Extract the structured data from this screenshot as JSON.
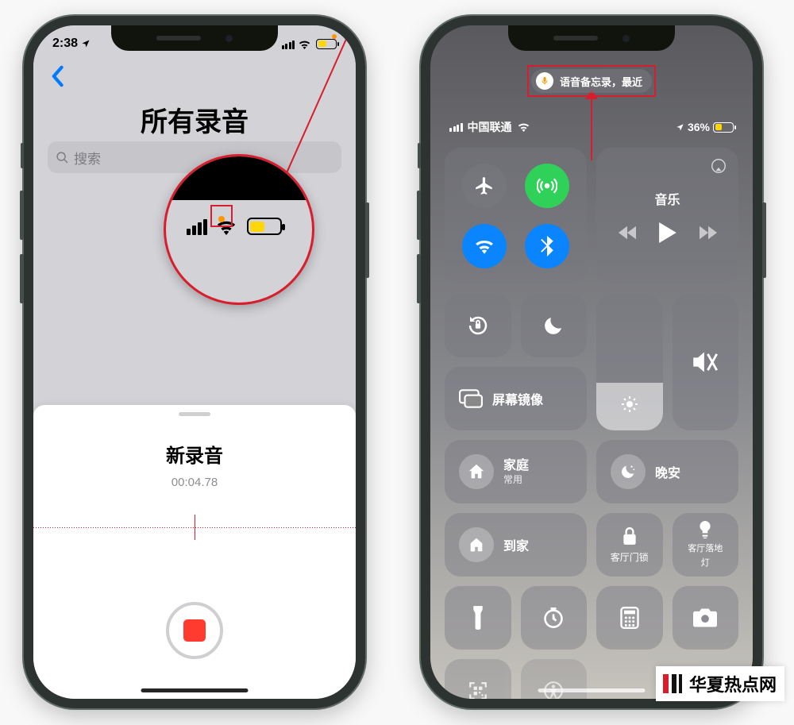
{
  "left_phone": {
    "status": {
      "time": "2:38"
    },
    "back": "‹",
    "title": "所有录音",
    "search_placeholder": "搜索",
    "recording": {
      "name": "新录音",
      "elapsed": "00:04.78"
    }
  },
  "right_phone": {
    "mic_pill": "语音备忘录，最近",
    "status": {
      "carrier": "中国联通",
      "battery": "36%"
    },
    "tiles": {
      "music": "音乐",
      "mirror": "屏幕镜像",
      "home_label": "家庭",
      "home_sub": "常用",
      "night": "晚安",
      "arrive": "到家",
      "doorlock": "客厅门锁",
      "floorlamp_1": "客厅落地",
      "floorlamp_2": "灯"
    }
  },
  "watermark": "华夏热点网"
}
